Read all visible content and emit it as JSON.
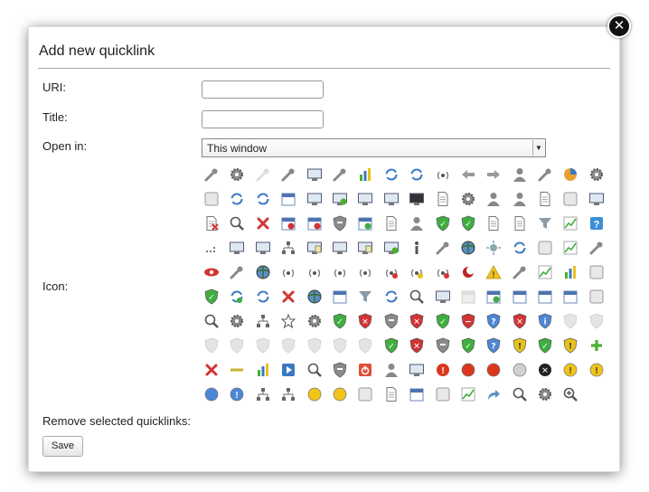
{
  "dialog": {
    "title": "Add new quicklink",
    "close_glyph": "✕"
  },
  "form": {
    "uri_label": "URI:",
    "uri_value": "",
    "title_label": "Title:",
    "title_value": "",
    "open_in_label": "Open in:",
    "open_in_value": "This window",
    "icon_label": "Icon:",
    "remove_label": "Remove selected quicklinks:",
    "save_label": "Save"
  },
  "icons": [
    [
      "pen-icon",
      "wrench-gear-icon",
      "hammer-disabled-icon",
      "hammer-icon",
      "monitor-icon",
      "edit-icon",
      "bar-chart-icon",
      "cycle-icon",
      "refresh-icon",
      "signal-icon",
      "arrow-left-icon",
      "arrow-right-icon",
      "users-icon",
      "key-icon",
      "pie-chart-icon",
      "close-gear-icon"
    ],
    [
      "check-disk-icon",
      "sync-icon",
      "cycle-disk-icon",
      "calendar-icon",
      "windows-icon",
      "add-window-icon",
      "window-icon",
      "windows-disabled-icon",
      "terminal-icon",
      "document-icon",
      "gear-icon",
      "user-group-icon",
      "user-icon",
      "copy-icon",
      "delete-icon",
      "close-window-icon"
    ],
    [
      "document-delete-icon",
      "search-delete-icon",
      "delete-x-icon",
      "calendar-delete-icon",
      "calendar-stop-icon",
      "shield-grey-icon",
      "calendar-check-icon",
      "note-icon",
      "user-edit-icon",
      "shield-check-icon",
      "shield-check-icon",
      "page-icon",
      "pages-icon",
      "filter-icon",
      "chart-line-icon",
      "help-icon"
    ],
    [
      "dots-icon",
      "network-monitor-icon",
      "network-monitor-icon",
      "network-icon",
      "monitor-document-icon",
      "monitor-icon",
      "monitor-chat-icon",
      "monitor-add-icon",
      "info-icon",
      "link-icon",
      "globe-icon",
      "sun-icon",
      "refresh-add-icon",
      "stars-icon",
      "chart-box-icon",
      "windmill-icon"
    ],
    [
      "eye-icon",
      "wrench-icon",
      "globe-dark-icon",
      "antenna-icon",
      "broadcast-icon",
      "broadcast-icon",
      "broadcast-icon",
      "broadcast-stop-icon",
      "broadcast-warning-icon",
      "broadcast-x-icon",
      "moon-icon",
      "warning-icon",
      "satellite-icon",
      "trend-icon",
      "bar-chart-box-icon",
      "id-card-icon"
    ],
    [
      "shield-check-icon",
      "cycle-check-icon",
      "sync-arrows-icon",
      "delete-x-icon",
      "pie-globe-icon",
      "calendar-grid-icon",
      "filter-icon",
      "mail-cycle-icon",
      "search-globe-icon",
      "monitor-signal-icon",
      "calendar-disabled-icon",
      "calendar-check-icon",
      "calendar-icon",
      "calendar-icon",
      "calendar-icon",
      "mail-icon"
    ],
    [
      "clipboard-search-icon",
      "gear-cycle-icon",
      "network-tree-icon",
      "star-icon",
      "gear-icon",
      "shield-check-icon",
      "shield-x-icon",
      "shield-grey-icon",
      "shield-x-icon",
      "shield-check-icon",
      "shield-minus-icon",
      "shield-help-icon",
      "shield-x-icon",
      "shield-info-icon",
      "shield-disabled-icon",
      "shield-disabled-icon"
    ],
    [
      "shield-disabled-icon",
      "shield-disabled-icon",
      "shield-disabled-icon",
      "shield-disabled-icon",
      "shield-disabled-icon",
      "shield-disabled-icon",
      "shield-disabled-icon",
      "shield-check-icon",
      "shield-x-icon",
      "shield-grey-icon",
      "shield-check-icon",
      "shield-help-icon",
      "shield-warning-icon",
      "shield-check-icon",
      "shield-warning-icon",
      "plus-icon"
    ],
    [
      "delete-x-icon",
      "minus-icon",
      "bar-chart-icon",
      "play-icon",
      "document-search-icon",
      "shield-cycle-icon",
      "power-icon",
      "user-dark-icon",
      "window-list-icon",
      "error-icon",
      "red-circle-icon",
      "red-circle-icon",
      "grey-circle-icon",
      "close-black-icon",
      "warning-circle-icon",
      "warning-circle-icon"
    ],
    [
      "blue-circle-icon",
      "info-circle-icon",
      "network-node-icon",
      "network-node-icon",
      "yellow-circle-icon",
      "yellow-circle-icon",
      "grid-icon",
      "document-icon",
      "calendar-icon",
      "table-icon",
      "chart-up-icon",
      "share-arrow-icon",
      "search-icon",
      "gear-search-icon",
      "zoom-in-icon"
    ]
  ]
}
